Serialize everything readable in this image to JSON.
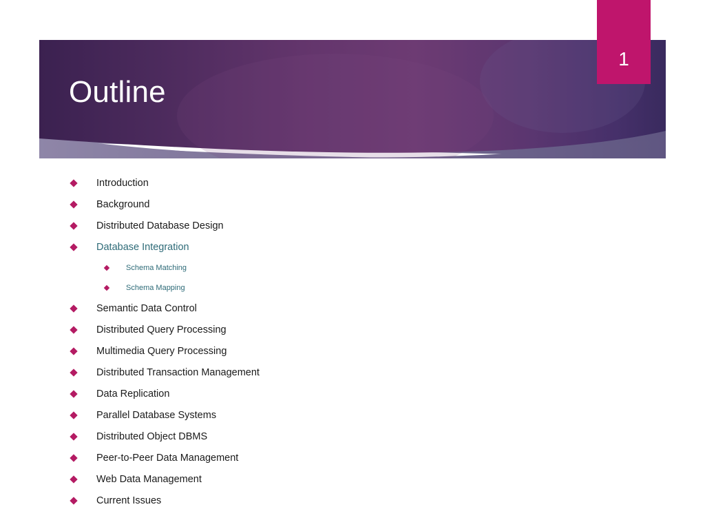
{
  "slide": {
    "title": "Outline",
    "number": "1",
    "colors": {
      "banner_dark": "#3d2350",
      "banner_mid": "#6b3a70",
      "banner_blue": "#4a3a6e",
      "banner_accent_band": "#6b6189",
      "badge_pink": "#bf156c",
      "bullet_diamond": "#b41b63",
      "text_primary": "#1a1a1a",
      "text_accent": "#2e6b78",
      "background": "#ffffff"
    }
  },
  "outline": {
    "items": [
      {
        "level": 0,
        "label": "Introduction",
        "accent": false
      },
      {
        "level": 0,
        "label": "Background",
        "accent": false
      },
      {
        "level": 0,
        "label": "Distributed Database Design",
        "accent": false
      },
      {
        "level": 0,
        "label": "Database Integration",
        "accent": true
      },
      {
        "level": 1,
        "label": "Schema Matching",
        "accent": true
      },
      {
        "level": 1,
        "label": "Schema Mapping",
        "accent": true
      },
      {
        "level": 0,
        "label": "Semantic Data Control",
        "accent": false
      },
      {
        "level": 0,
        "label": "Distributed Query Processing",
        "accent": false
      },
      {
        "level": 0,
        "label": "Multimedia Query Processing",
        "accent": false
      },
      {
        "level": 0,
        "label": "Distributed Transaction Management",
        "accent": false
      },
      {
        "level": 0,
        "label": "Data Replication",
        "accent": false
      },
      {
        "level": 0,
        "label": "Parallel Database Systems",
        "accent": false
      },
      {
        "level": 0,
        "label": "Distributed Object DBMS",
        "accent": false
      },
      {
        "level": 0,
        "label": "Peer-to-Peer Data Management",
        "accent": false
      },
      {
        "level": 0,
        "label": "Web Data Management",
        "accent": false
      },
      {
        "level": 0,
        "label": "Current Issues",
        "accent": false
      }
    ]
  }
}
